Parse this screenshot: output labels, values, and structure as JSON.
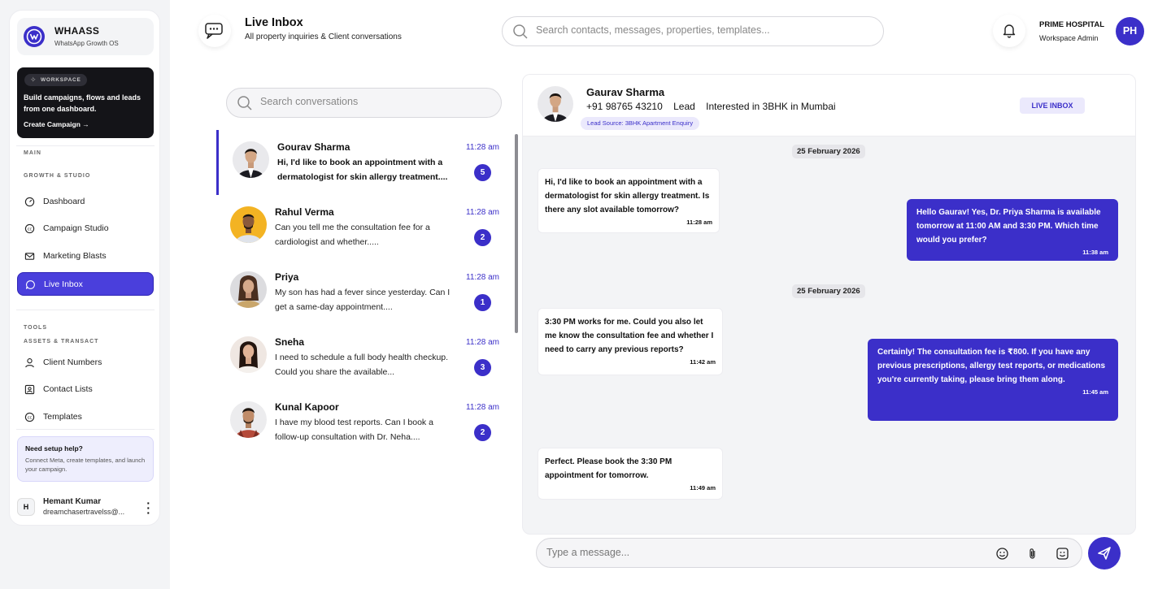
{
  "brand": {
    "name": "WHAASS",
    "tagline": "WhatsApp Growth OS"
  },
  "workspace": {
    "badge": "WORKSPACE",
    "headline": "Build campaigns, flows and leads from one dashboard.",
    "cta": "Create Campaign"
  },
  "sidebar": {
    "main_label": "MAIN",
    "growth_label": "GROWTH & STUDIO",
    "growth_items": [
      {
        "label": "Dashboard",
        "icon": "dashboard-icon"
      },
      {
        "label": "Campaign Studio",
        "icon": "campaign-icon"
      },
      {
        "label": "Marketing Blasts",
        "icon": "mail-icon"
      },
      {
        "label": "Live Inbox",
        "icon": "chat-icon",
        "active": true
      }
    ],
    "tools_label": "TOOLS",
    "assets_label": "ASSETS & TRANSACT",
    "asset_items": [
      {
        "label": "Client Numbers",
        "icon": "user-icon"
      },
      {
        "label": "Contact Lists",
        "icon": "contacts-icon"
      },
      {
        "label": "Templates",
        "icon": "template-icon"
      }
    ],
    "help": {
      "title": "Need setup help?",
      "text": "Connect Meta, create templates, and launch your campaign."
    },
    "user": {
      "initial": "H",
      "name": "Hemant Kumar",
      "email": "dreamchasertravelss@..."
    }
  },
  "header": {
    "title": "Live Inbox",
    "subtitle": "All property inquiries & Client conversations",
    "search_placeholder": "Search contacts, messages, properties, templates...",
    "org_name": "PRIME HOSPITAL",
    "org_role": "Workspace Admin",
    "org_initials": "PH"
  },
  "conversation_list": {
    "search_placeholder": "Search conversations",
    "items": [
      {
        "name": "Gourav Sharma",
        "time": "11:28 am",
        "preview": "Hi, I'd like to book an appointment with a dermatologist for skin allergy treatment....",
        "unread": "5",
        "active": true
      },
      {
        "name": "Rahul Verma",
        "time": "11:28 am",
        "preview": "Can you tell me the consultation fee for a cardiologist and whether.....",
        "unread": "2"
      },
      {
        "name": "Priya",
        "time": "11:28 am",
        "preview": "My son has had a fever since yesterday. Can I get a same-day appointment....",
        "unread": "1"
      },
      {
        "name": "Sneha",
        "time": "11:28 am",
        "preview": "I need to schedule a full body health checkup. Could you share the available...",
        "unread": "3"
      },
      {
        "name": "Kunal  Kapoor",
        "time": "11:28 am",
        "preview": "I have my blood test reports. Can I book a follow-up consultation with Dr. Neha....",
        "unread": "2"
      }
    ]
  },
  "chat": {
    "contact_name": "Gaurav Sharma",
    "phone": "+91 98765 43210",
    "status": "Lead",
    "interest": "Interested in 3BHK in Mumbai",
    "lead_source": "Lead Source: 3BHK Apartment Enquiry",
    "badge": "LIVE INBOX",
    "date_1": "25 February 2026",
    "date_2": "25 February 2026",
    "messages": [
      {
        "dir": "in",
        "text": "Hi, I'd like to book an appointment with a dermatologist for skin allergy treatment. Is there any slot available tomorrow?",
        "time": "11:28 am"
      },
      {
        "dir": "out",
        "text": "Hello Gaurav! Yes, Dr. Priya Sharma is available tomorrow at 11:00 AM and 3:30 PM. Which time would you prefer?",
        "time": "11:38 am"
      },
      {
        "dir": "in",
        "text": "3:30 PM works for me. Could you also let me know the consultation fee and whether I need to carry any previous reports?",
        "time": "11:42 am"
      },
      {
        "dir": "out",
        "text": "Certainly! The consultation fee is ₹800. If you have any previous prescriptions, allergy test reports, or medications you're currently taking, please bring them along.",
        "time": "11:45 am"
      },
      {
        "dir": "in",
        "text": "Perfect. Please book the 3:30 PM appointment for tomorrow.",
        "time": "11:49 am"
      }
    ],
    "composer_placeholder": "Type a message..."
  },
  "colors": {
    "accent": "#3b2fc9",
    "accent_soft": "#ebe9fc",
    "sidebar_bg": "#f3f4f6",
    "dark_card": "#141418"
  }
}
